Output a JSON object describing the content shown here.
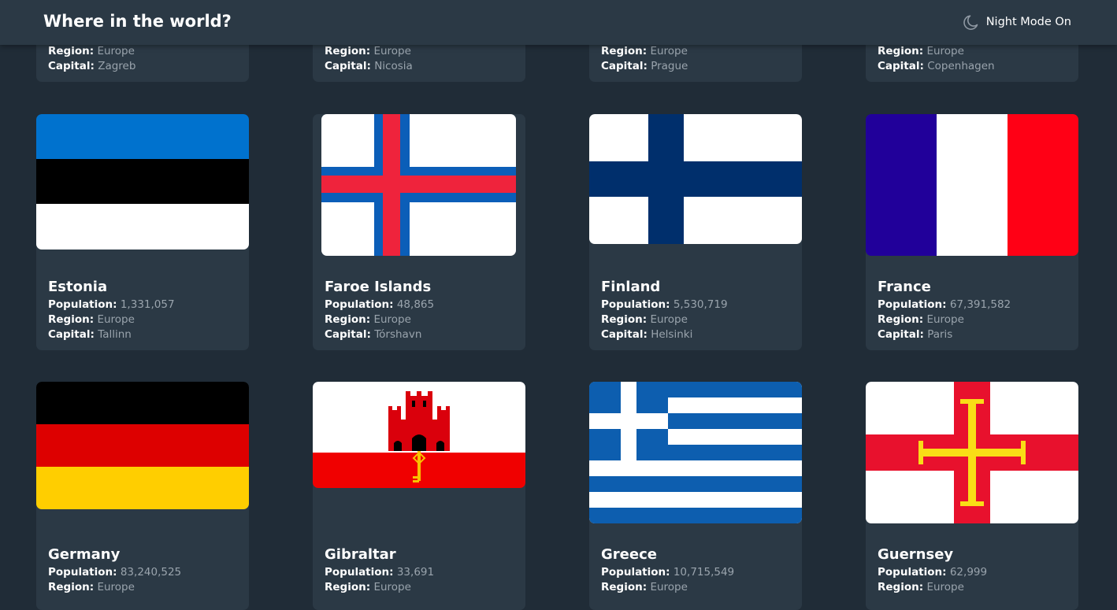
{
  "header": {
    "title": "Where in the world?",
    "mode_label": "Night Mode On",
    "mode_icon": "moon-icon"
  },
  "labels": {
    "population": "Population:",
    "region": "Region:",
    "capital": "Capital:"
  },
  "partial_row": [
    {
      "region": "Europe",
      "capital": "Zagreb"
    },
    {
      "region": "Europe",
      "capital": "Nicosia"
    },
    {
      "region": "Europe",
      "capital": "Prague"
    },
    {
      "region": "Europe",
      "capital": "Copenhagen"
    }
  ],
  "countries": [
    {
      "name": "Estonia",
      "population": "1,331,057",
      "region": "Europe",
      "capital": "Tallinn"
    },
    {
      "name": "Faroe Islands",
      "population": "48,865",
      "region": "Europe",
      "capital": "Tórshavn"
    },
    {
      "name": "Finland",
      "population": "5,530,719",
      "region": "Europe",
      "capital": "Helsinki"
    },
    {
      "name": "France",
      "population": "67,391,582",
      "region": "Europe",
      "capital": "Paris"
    },
    {
      "name": "Germany",
      "population": "83,240,525",
      "region": "Europe"
    },
    {
      "name": "Gibraltar",
      "population": "33,691",
      "region": "Europe"
    },
    {
      "name": "Greece",
      "population": "10,715,549",
      "region": "Europe"
    },
    {
      "name": "Guernsey",
      "population": "62,999",
      "region": "Europe"
    }
  ],
  "colors": {
    "background": "#202c37",
    "card": "#2b3945",
    "text": "#ffffff",
    "muted": "#9aa4ad"
  }
}
